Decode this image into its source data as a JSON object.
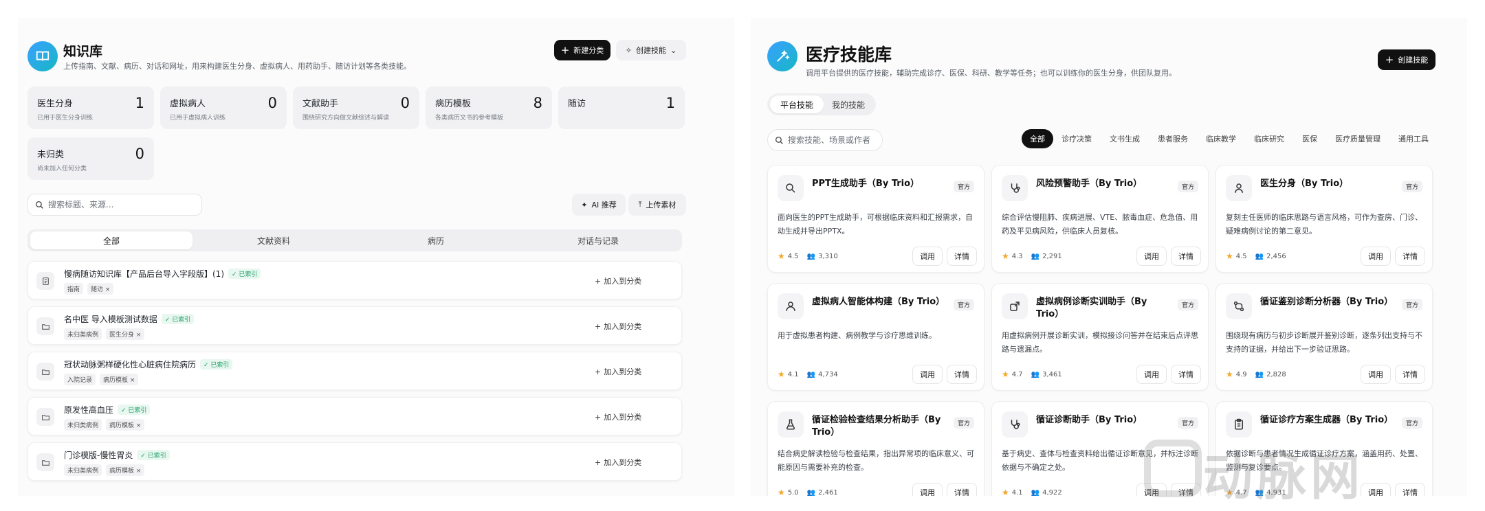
{
  "left": {
    "title": "知识库",
    "subtitle": "上传指南、文献、病历、对话和网址，用来构建医生分身、虚拟病人、用药助手、随访计划等各类技能。",
    "new_category_label": "新建分类",
    "create_skill_label": "创建技能",
    "stats": [
      {
        "label": "医生分身",
        "sub": "已用于医生分身训练",
        "count": "1"
      },
      {
        "label": "虚拟病人",
        "sub": "已用于虚拟病人训练",
        "count": "0"
      },
      {
        "label": "文献助手",
        "sub": "围绕研究方向做文献综述与解读",
        "count": "0"
      },
      {
        "label": "病历模板",
        "sub": "各类病历文书的参考模板",
        "count": "8"
      },
      {
        "label": "随访",
        "sub": "",
        "count": "1"
      },
      {
        "label": "未归类",
        "sub": "尚未加入任何分类",
        "count": "0"
      }
    ],
    "search_placeholder": "搜索标题、来源...",
    "ai_recommend_label": "AI 推荐",
    "upload_label": "上传素材",
    "tabs": [
      "全部",
      "文献资料",
      "病历",
      "对话与记录"
    ],
    "rows": [
      {
        "name": "慢病随访知识库【产品后台导入字段版】(1)",
        "badge": "✓ 已索引",
        "tags": [
          "指南",
          "随访 ×"
        ],
        "action": "加入到分类"
      },
      {
        "name": "名中医 导入模板测试数据",
        "badge": "✓ 已索引",
        "tags": [
          "未归类病例",
          "医生分身 ×"
        ],
        "action": "加入到分类"
      },
      {
        "name": "冠状动脉粥样硬化性心脏病住院病历",
        "badge": "✓ 已索引",
        "tags": [
          "入院记录",
          "病历模板 ×"
        ],
        "action": "加入到分类"
      },
      {
        "name": "原发性高血压",
        "badge": "✓ 已索引",
        "tags": [
          "未归类病例",
          "病历模板 ×"
        ],
        "action": "加入到分类"
      },
      {
        "name": "门诊模版-慢性胃炎",
        "badge": "✓ 已索引",
        "tags": [
          "未归类病例",
          "病历模板 ×"
        ],
        "action": "加入到分类"
      }
    ]
  },
  "right": {
    "title": "医疗技能库",
    "subtitle": "调用平台提供的医疗技能，辅助完成诊疗、医保、科研、教学等任务；也可以训练你的医生分身，供团队复用。",
    "create_skill_label": "创建技能",
    "seg_tabs": [
      "平台技能",
      "我的技能"
    ],
    "search_placeholder": "搜索技能、场景或作者",
    "filters": [
      "全部",
      "诊疗决策",
      "文书生成",
      "患者服务",
      "临床教学",
      "临床研究",
      "医保",
      "医疗质量管理",
      "通用工具"
    ],
    "official_label": "官方",
    "use_label": "调用",
    "detail_label": "详情",
    "cards": [
      {
        "icon": "search-icon",
        "name": "PPT生成助手（By Trio）",
        "desc": "面向医生的PPT生成助手，可根据临床资料和汇报需求，自动生成并导出PPTX。",
        "rating": "4.5",
        "users": "3,310"
      },
      {
        "icon": "stethoscope-icon",
        "name": "风险预警助手（By Trio）",
        "desc": "综合评估慢阻肺、疾病进展、VTE、脓毒血症、危急值、用药及平见病风险，供临床人员复核。",
        "rating": "4.3",
        "users": "2,291"
      },
      {
        "icon": "doctor-icon",
        "name": "医生分身（By Trio）",
        "desc": "复刻主任医师的临床思路与语言风格，可作为查房、门诊、疑难病例讨论的第二意见。",
        "rating": "4.5",
        "users": "2,456"
      },
      {
        "icon": "user-icon",
        "name": "虚拟病人智能体构建（By Trio）",
        "desc": "用于虚拟患者构建、病例教学与诊疗思维训练。",
        "rating": "4.1",
        "users": "4,734"
      },
      {
        "icon": "virtual-case-icon",
        "name": "虚拟病例诊断实训助手（By Trio）",
        "desc": "用虚拟病例开展诊断实训，模拟接诊问答并在结束后点评思路与遗漏点。",
        "rating": "4.7",
        "users": "3,461"
      },
      {
        "icon": "diff-icon",
        "name": "循证鉴别诊断分析器（By Trio）",
        "desc": "围绕现有病历与初步诊断展开鉴别诊断，逐条列出支持与不支持的证据，并给出下一步验证思路。",
        "rating": "4.9",
        "users": "2,828"
      },
      {
        "icon": "flask-icon",
        "name": "循证检验检查结果分析助手（By Trio）",
        "desc": "结合病史解读检验与检查结果，指出异常项的临床意义、可能原因与需要补充的检查。",
        "rating": "5.0",
        "users": "2,461"
      },
      {
        "icon": "stethoscope-icon",
        "name": "循证诊断助手（By Trio）",
        "desc": "基于病史、查体与检查资料给出循证诊断意见，并标注诊断依据与不确定之处。",
        "rating": "4.1",
        "users": "4,922"
      },
      {
        "icon": "clipboard-icon",
        "name": "循证诊疗方案生成器（By Trio）",
        "desc": "依据诊断与患者情况生成循证诊疗方案，涵盖用药、处置、监测与复诊要点。",
        "rating": "4.7",
        "users": "4,931"
      }
    ]
  },
  "watermark": "动脉网",
  "colors": {
    "accent_from": "#3aa0ff",
    "accent_to": "#16b7c4",
    "dark": "#111111",
    "indexed_green": "#22a06b",
    "star": "#f5a623"
  }
}
